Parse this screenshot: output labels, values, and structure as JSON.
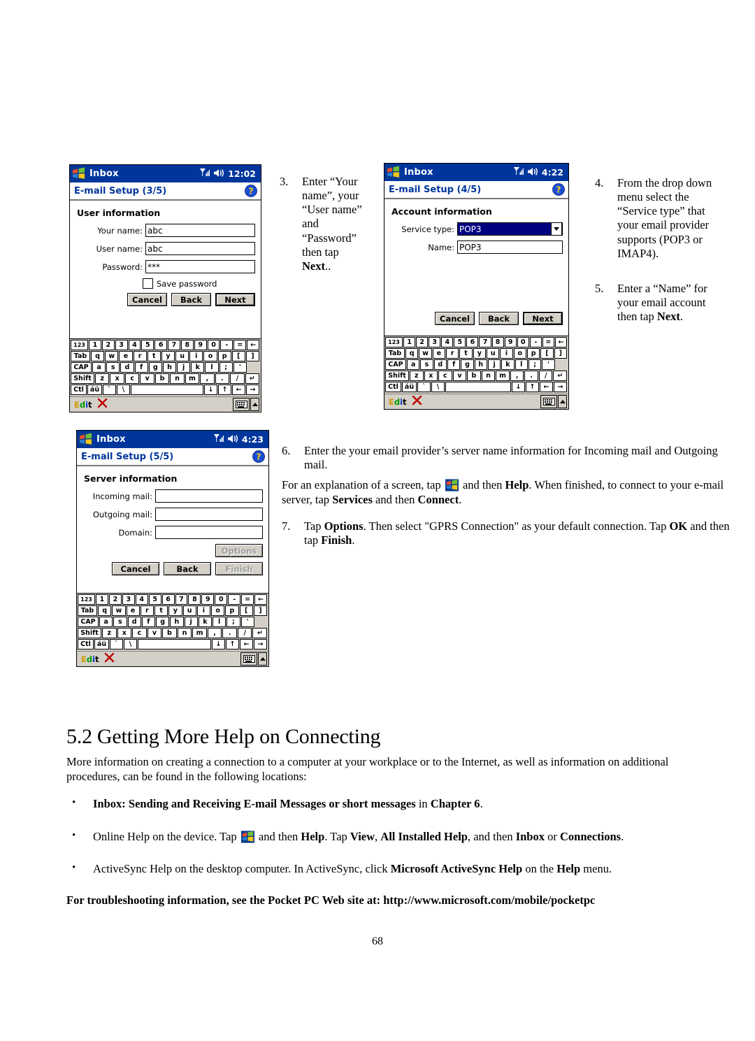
{
  "page": {
    "number": "68",
    "section_heading": {
      "number": "5.2",
      "title": "Getting More Help on Connecting"
    },
    "intro_paragraph": "More information on creating a connection to a computer at your workplace or to the Internet, as well as information on additional procedures, can be found in the following locations:",
    "troubleshooting_note": "For troubleshooting information, see the Pocket PC Web site at: http://www.microsoft.com/mobile/pocketpc"
  },
  "steps": {
    "step3": {
      "number": "3.",
      "text": "Enter “Your name”, your “User name” and “Password” ",
      "bold": "Next",
      "lead": "then tap ",
      "tail": ".."
    },
    "step4": {
      "number": "4.",
      "text": "From the drop down menu select the “Service type” that your email provider supports (POP3 or IMAP4)."
    },
    "step5": {
      "number": "5.",
      "pre": "Enter a “Name” for your email account then tap ",
      "bold": "Next",
      "post": ".",
      "numlabel": "5."
    },
    "step6": {
      "number": "6.",
      "text": "Enter the your email provider’s server name information for Incoming mail and Outgoing mail.",
      "para_a1": "For an explanation of a screen, tap ",
      "para_a2": " and then ",
      "para_a_bold1": "Help",
      "para_a3": ". When finished, to connect to your e-mail server, tap ",
      "para_a_bold2": "Services",
      "para_a4": " and then ",
      "para_a_bold3": "Connect",
      "para_a5": "."
    },
    "step7": {
      "number": "7.",
      "p1": "Tap ",
      "b1": "Options",
      "p2": ".  Then select \"GPRS Connection\" as your default connection.  Tap ",
      "b2": "OK",
      "p3": " and then tap ",
      "b3": "Finish",
      "p4": "."
    }
  },
  "bullets": [
    {
      "marker": "•",
      "bold_lead": "Inbox: Sending and Receiving E-mail Messages or short messages",
      "mid": " in ",
      "bold_tail": "Chapter 6",
      "end": "."
    },
    {
      "marker": "•",
      "p1": "Online Help on the device. Tap ",
      "icon": "windows-start-icon",
      "p2": " and then ",
      "b1": "Help",
      "p3": ". Tap ",
      "b2": "View",
      "p4": ", ",
      "b3": "All Installed Help",
      "p5": ", and then ",
      "b4": "Inbox",
      "p6": " or ",
      "b5": "Connections",
      "p7": "."
    },
    {
      "marker": "•",
      "p1": "ActiveSync Help on the desktop computer. In ActiveSync, click ",
      "b1": "Microsoft ActiveSync Help",
      "p2": " on the ",
      "b2": "Help",
      "p3": " menu."
    }
  ],
  "devices": {
    "screen1": {
      "title": "Inbox",
      "clock": "12:02",
      "subtitle": "E-mail Setup (3/5)",
      "group_label": "User information",
      "fields": [
        {
          "label": "Your name:",
          "value": "abc"
        },
        {
          "label": "User name:",
          "value": "abc"
        },
        {
          "label": "Password:",
          "value": "***"
        }
      ],
      "checkbox_label": "Save password",
      "checkbox_checked": false,
      "buttons": [
        {
          "label": "Cancel",
          "state": "normal"
        },
        {
          "label": "Back",
          "state": "normal"
        },
        {
          "label": "Next",
          "state": "default"
        }
      ],
      "status_label": "Edit"
    },
    "screen2": {
      "title": "Inbox",
      "clock": "4:22",
      "subtitle": "E-mail Setup (4/5)",
      "group_label": "Account information",
      "fields": [
        {
          "label": "Service type:",
          "value": "POP3",
          "type": "combo"
        },
        {
          "label": "Name:",
          "value": "POP3",
          "type": "text"
        }
      ],
      "buttons": [
        {
          "label": "Cancel",
          "state": "normal"
        },
        {
          "label": "Back",
          "state": "normal"
        },
        {
          "label": "Next",
          "state": "default"
        }
      ],
      "status_label": "Edit"
    },
    "screen3": {
      "title": "Inbox",
      "clock": "4:23",
      "subtitle": "E-mail Setup (5/5)",
      "group_label": "Server information",
      "fields": [
        {
          "label": "Incoming mail:",
          "value": ""
        },
        {
          "label": "Outgoing mail:",
          "value": ""
        },
        {
          "label": "Domain:",
          "value": ""
        }
      ],
      "options_button": {
        "label": "Options",
        "state": "disabled"
      },
      "buttons": [
        {
          "label": "Cancel",
          "state": "normal"
        },
        {
          "label": "Back",
          "state": "normal"
        },
        {
          "label": "Finish",
          "state": "disabled"
        }
      ],
      "status_label": "Edit"
    }
  },
  "keyboard": {
    "rows": [
      [
        "123",
        "1",
        "2",
        "3",
        "4",
        "5",
        "6",
        "7",
        "8",
        "9",
        "0",
        "-",
        "=",
        "←"
      ],
      [
        "Tab",
        "q",
        "w",
        "e",
        "r",
        "t",
        "y",
        "u",
        "i",
        "o",
        "p",
        "[",
        "]"
      ],
      [
        "CAP",
        "a",
        "s",
        "d",
        "f",
        "g",
        "h",
        "j",
        "k",
        "l",
        ";",
        "'"
      ],
      [
        "Shift",
        "z",
        "x",
        "c",
        "v",
        "b",
        "n",
        "m",
        ",",
        ".",
        "/",
        "↵"
      ],
      [
        "Ctl",
        "áü",
        "`",
        "\\",
        " ",
        "↓",
        "↑",
        "←",
        "→"
      ]
    ]
  },
  "colors": {
    "titlebar_blue": "#00369c",
    "subtitle_blue": "#00369c",
    "combo_selected": "#000080",
    "chrome_gray": "#d4d0c8",
    "help_icon_blue": "#1c4fd8",
    "help_icon_yellow": "#ffd500"
  }
}
